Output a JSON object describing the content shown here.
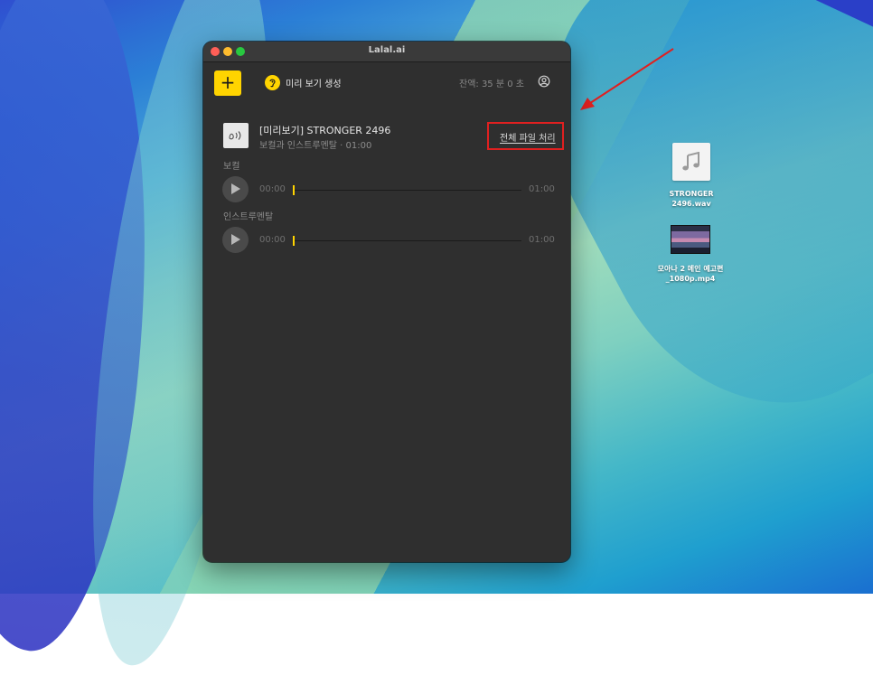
{
  "window": {
    "title": "Lalal.ai"
  },
  "toolbar": {
    "add_label": "+",
    "preview_label": "미리 보기 생성",
    "balance": "잔액: 35 분 0 초"
  },
  "track": {
    "title": "[미리보기] STRONGER 2496",
    "subtitle": "보컬과 인스트루멘탈 · 01:00",
    "process_full_label": "전체 파일 처리"
  },
  "stems": [
    {
      "label": "보컬",
      "current_time": "00:00",
      "duration": "01:00",
      "progress": 0
    },
    {
      "label": "인스트루멘탈",
      "current_time": "00:00",
      "duration": "01:00",
      "progress": 0
    }
  ],
  "desktop": {
    "files": [
      {
        "name_line1": "STRONGER",
        "name_line2": "2496.wav",
        "icon": "music-note-icon"
      },
      {
        "name_line1": "모아나 2 메인 예고편",
        "name_line2": "_1080p.mp4",
        "icon": "video-thumbnail"
      }
    ]
  },
  "colors": {
    "accent": "#ffd400",
    "window_bg": "#2f2f2f",
    "highlight": "#e02020"
  }
}
